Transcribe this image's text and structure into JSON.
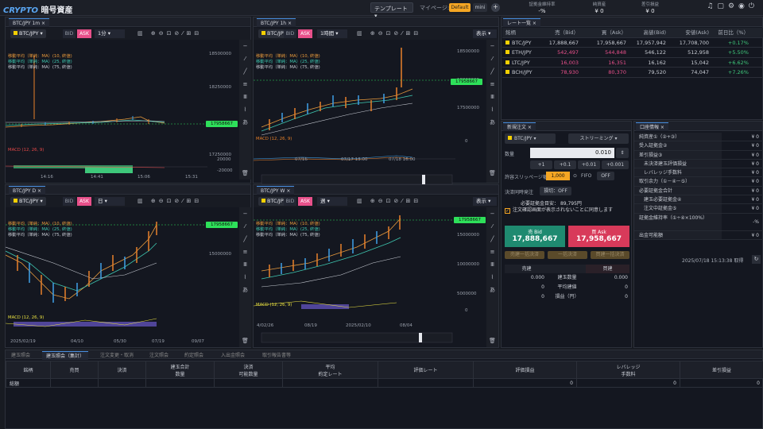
{
  "app": {
    "logo_crypto": "CRYPTO",
    "logo_text": "暗号資産"
  },
  "topbar": {
    "template_label": "テンプレート",
    "mypage_label": "マイページ:",
    "default_label": "Default",
    "mini_label": "mini",
    "stats": [
      {
        "label": "証拠金維持率",
        "value": "-%"
      },
      {
        "label": "純資産",
        "value": "¥ 0"
      },
      {
        "label": "差引損益",
        "value": "¥ 0"
      }
    ]
  },
  "charts": [
    {
      "tab": "BTC/JPY 1m",
      "symbol": "BTC/JPY",
      "bid": "BID",
      "ask": "ASK",
      "timeframe": "1分",
      "legend": [
        "移動平均（単純：MA）(10, 終値)",
        "移動平均（単純：MA）(25, 終値)",
        "移動平均（単純：MA）(75, 終値)"
      ],
      "yticks": [
        "18500000",
        "18250000",
        "18000000",
        "17500000",
        "17250000"
      ],
      "price_tag": "17958667",
      "macd": "MACD (12, 26, 9)",
      "macd_ticks": [
        "20000",
        "0",
        "-20000"
      ],
      "xticks": [
        "14:16",
        "14:41",
        "15:06",
        "15:31"
      ]
    },
    {
      "tab": "BTC/JPY 1h",
      "symbol": "BTC/JPY",
      "bid": "BID",
      "ask": "ASK",
      "timeframe": "1時間",
      "display": "表示",
      "legend": [
        "移動平均（単純：MA）(10, 終値)",
        "移動平均（単純：MA）(25, 終値)",
        "移動平均（単純：MA）(75, 終値)"
      ],
      "yticks": [
        "18500000",
        "18000000",
        "17500000"
      ],
      "price_tag": "17958667",
      "macd": "MACD (12, 26, 9)",
      "macd_ticks": [
        "0"
      ],
      "xticks": [
        "07/16",
        "07/17 13:00",
        "07/18 16:00"
      ]
    },
    {
      "tab": "BTC/JPY D",
      "symbol": "BTC/JPY",
      "bid": "BID",
      "ask": "ASK",
      "timeframe": "日",
      "legend": [
        "移動平均（単純：MA）(10, 終値)",
        "移動平均（単純：MA）(25, 終値)",
        "移動平均（単純：MA）(75, 終値)"
      ],
      "yticks": [
        "15000000"
      ],
      "price_tag": "17958667",
      "macd": "MACD (12, 26, 9)",
      "macd_ticks": [],
      "xticks": [
        "2025/02/19",
        "04/10",
        "05/30",
        "07/19",
        "09/07"
      ]
    },
    {
      "tab": "BTC/JPY W",
      "symbol": "BTC/JPY",
      "bid": "BID",
      "ask": "ASK",
      "timeframe": "週",
      "display": "表示",
      "legend": [
        "移動平均（単純：MA）(10, 終値)",
        "移動平均（単純：MA）(25, 終値)",
        "移動平均（単純：MA）(75, 終値)"
      ],
      "yticks": [
        "15000000",
        "10000000",
        "5000000"
      ],
      "price_tag": "17958667",
      "macd": "MACD (12, 26, 9)",
      "macd_ticks": [
        "0"
      ],
      "xticks": [
        "4/02/26",
        "08/19",
        "2025/02/10",
        "08/04"
      ]
    }
  ],
  "rates": {
    "tab": "レート一覧",
    "headers": [
      "銘柄",
      "売（Bid）",
      "買（Ask）",
      "高値(Bid)",
      "安値(Ask)",
      "前日比（%）"
    ],
    "rows": [
      {
        "sym": "BTC/JPY",
        "bid": "17,888,667",
        "ask": "17,958,667",
        "high": "17,957,942",
        "low": "17,708,700",
        "chg": "+0.17%",
        "red": false
      },
      {
        "sym": "ETH/JPY",
        "bid": "542,497",
        "ask": "544,848",
        "high": "546,122",
        "low": "512,958",
        "chg": "+5.50%",
        "red": true
      },
      {
        "sym": "LTC/JPY",
        "bid": "16,003",
        "ask": "16,351",
        "high": "16,162",
        "low": "15,042",
        "chg": "+6.62%",
        "red": true
      },
      {
        "sym": "BCH/JPY",
        "bid": "78,930",
        "ask": "80,370",
        "high": "79,520",
        "low": "74,047",
        "chg": "+7.26%",
        "red": true
      }
    ]
  },
  "order": {
    "tab": "新規注文",
    "symbol": "BTC/JPY",
    "mode": "ストリーミング",
    "qty_label": "数量",
    "qty_value": "0.010",
    "steps": [
      "+1",
      "+0.1",
      "+0.01",
      "+0.001"
    ],
    "slip_label": "許容スリッページ幅",
    "slip_value": "1,000",
    "fifo_label": "FIFO",
    "fifo_value": "OFF",
    "settle_label": "決済同時発注",
    "settle_value": "損切：OFF",
    "margin_label": "必要証拠金目安：",
    "margin_value": "89,795円",
    "confirm_text": "注文確認画面が表示されないことに同意します",
    "sell_label": "売 Bid",
    "sell_price": "17,888,667",
    "buy_label": "買 Ask",
    "buy_price": "17,958,667",
    "bulk": [
      "売建一括決済",
      "一括決済",
      "買建一括決済"
    ],
    "pos_head_sell": "売建",
    "pos_head_buy": "買建",
    "pos_rows": [
      {
        "l": "0.000",
        "k": "建玉数量",
        "r": "0.000"
      },
      {
        "l": "0",
        "k": "平均建値",
        "r": "0"
      },
      {
        "l": "0",
        "k": "損益（円）",
        "r": "0"
      }
    ]
  },
  "account": {
    "tab": "口座情報",
    "rows": [
      {
        "k": "純資産①（②+③）",
        "v": "¥ 0"
      },
      {
        "k": "受入証拠金②",
        "v": "¥ 0"
      },
      {
        "k": "差引損益③",
        "v": "¥ 0"
      },
      {
        "k": "　未決済建玉評価損益",
        "v": "¥ 0"
      },
      {
        "k": "　レバレッジ手数料",
        "v": "¥ 0"
      },
      {
        "k": "取引余力（①－④－⑤）",
        "v": "¥ 0"
      },
      {
        "k": "必要証拠金合計",
        "v": "¥ 0"
      },
      {
        "k": "　建玉必要証拠金④",
        "v": "¥ 0"
      },
      {
        "k": "　注文中証拠金⑤",
        "v": "¥ 0"
      },
      {
        "k": "証拠金維持率（①÷④×100%）",
        "v": "-%"
      },
      {
        "k": "出金可能額",
        "v": "¥ 0"
      }
    ],
    "timestamp": "2025/07/18 15:13:38 取得"
  },
  "bottom": {
    "tabs": [
      "建玉照会",
      "建玉照会（集計）",
      "注文変更・取消",
      "注文照会",
      "約定照会",
      "入出金照会",
      "取引報告書等"
    ],
    "active": 1,
    "headers": [
      "銘柄",
      "売買",
      "決済",
      "建玉合計\n数量",
      "決済\n可能数量",
      "平均\n約定レート",
      "評価レート",
      "評価損益",
      "レバレッジ\n手数料",
      "差引損益"
    ],
    "row": [
      "総額",
      "",
      "",
      "",
      "",
      "",
      "",
      "0",
      "0",
      "0"
    ]
  }
}
